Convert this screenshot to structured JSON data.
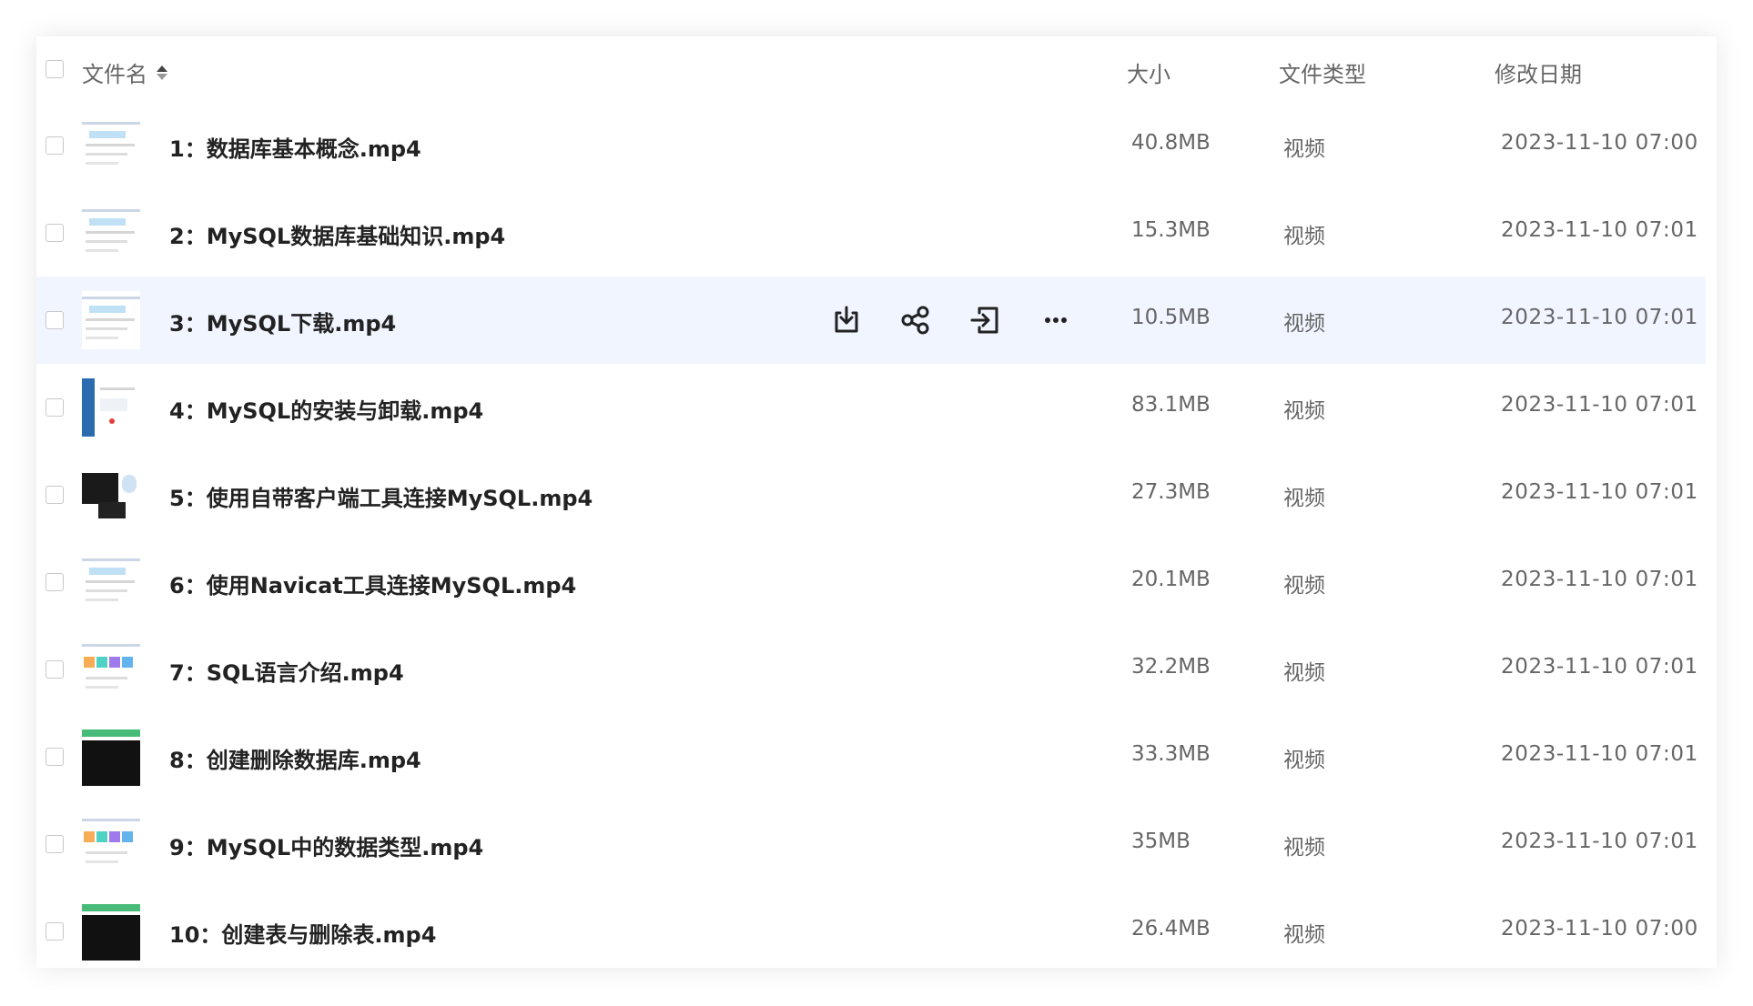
{
  "header": {
    "name": "文件名",
    "size": "大小",
    "type": "文件类型",
    "date": "修改日期"
  },
  "files": [
    {
      "name": "1：数据库基本概念.mp4",
      "size": "40.8MB",
      "type": "视频",
      "date": "2023-11-10 07:00",
      "thumb": "light"
    },
    {
      "name": "2：MySQL数据库基础知识.mp4",
      "size": "15.3MB",
      "type": "视频",
      "date": "2023-11-10 07:01",
      "thumb": "light"
    },
    {
      "name": "3：MySQL下载.mp4",
      "size": "10.5MB",
      "type": "视频",
      "date": "2023-11-10 07:01",
      "thumb": "light"
    },
    {
      "name": "4：MySQL的安装与卸载.mp4",
      "size": "83.1MB",
      "type": "视频",
      "date": "2023-11-10 07:01",
      "thumb": "blue-side"
    },
    {
      "name": "5：使用自带客户端工具连接MySQL.mp4",
      "size": "27.3MB",
      "type": "视频",
      "date": "2023-11-10 07:01",
      "thumb": "dark"
    },
    {
      "name": "6：使用Navicat工具连接MySQL.mp4",
      "size": "20.1MB",
      "type": "视频",
      "date": "2023-11-10 07:01",
      "thumb": "light"
    },
    {
      "name": "7：SQL语言介绍.mp4",
      "size": "32.2MB",
      "type": "视频",
      "date": "2023-11-10 07:01",
      "thumb": "colorful"
    },
    {
      "name": "8：创建删除数据库.mp4",
      "size": "33.3MB",
      "type": "视频",
      "date": "2023-11-10 07:01",
      "thumb": "terminal"
    },
    {
      "name": "9：MySQL中的数据类型.mp4",
      "size": "35MB",
      "type": "视频",
      "date": "2023-11-10 07:01",
      "thumb": "colorful"
    },
    {
      "name": "10：创建表与删除表.mp4",
      "size": "26.4MB",
      "type": "视频",
      "date": "2023-11-10 07:00",
      "thumb": "terminal"
    }
  ],
  "hover_row": 2,
  "row_actions": [
    "download-icon",
    "share-icon",
    "move-icon",
    "more-icon"
  ],
  "colors": {
    "hover_bg": "#f0f5ff",
    "text": "#222222",
    "muted": "#666666"
  }
}
